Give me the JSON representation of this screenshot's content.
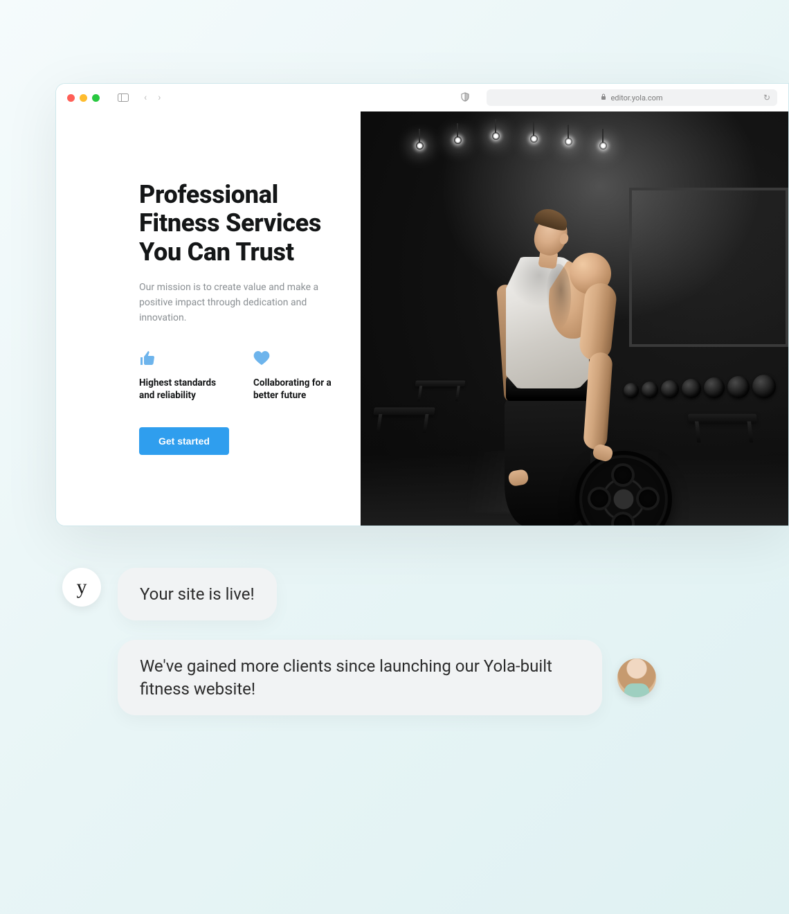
{
  "browser": {
    "url": "editor.yola.com"
  },
  "hero": {
    "title": "Professional Fitness Services You Can Trust",
    "subtitle": "Our mission is to create value and make a positive impact through dedication and innovation.",
    "features": [
      {
        "icon": "thumbs-up-icon",
        "text": "Highest standards and reliability"
      },
      {
        "icon": "heart-icon",
        "text": "Collaborating for a better future"
      }
    ],
    "cta_label": "Get started"
  },
  "chat": {
    "system_avatar_letter": "y",
    "messages": [
      "Your site is live!",
      "We've gained more clients since launching our Yola-built fitness website!"
    ]
  },
  "colors": {
    "accent": "#2f9eee",
    "icon": "#6db4ec"
  }
}
